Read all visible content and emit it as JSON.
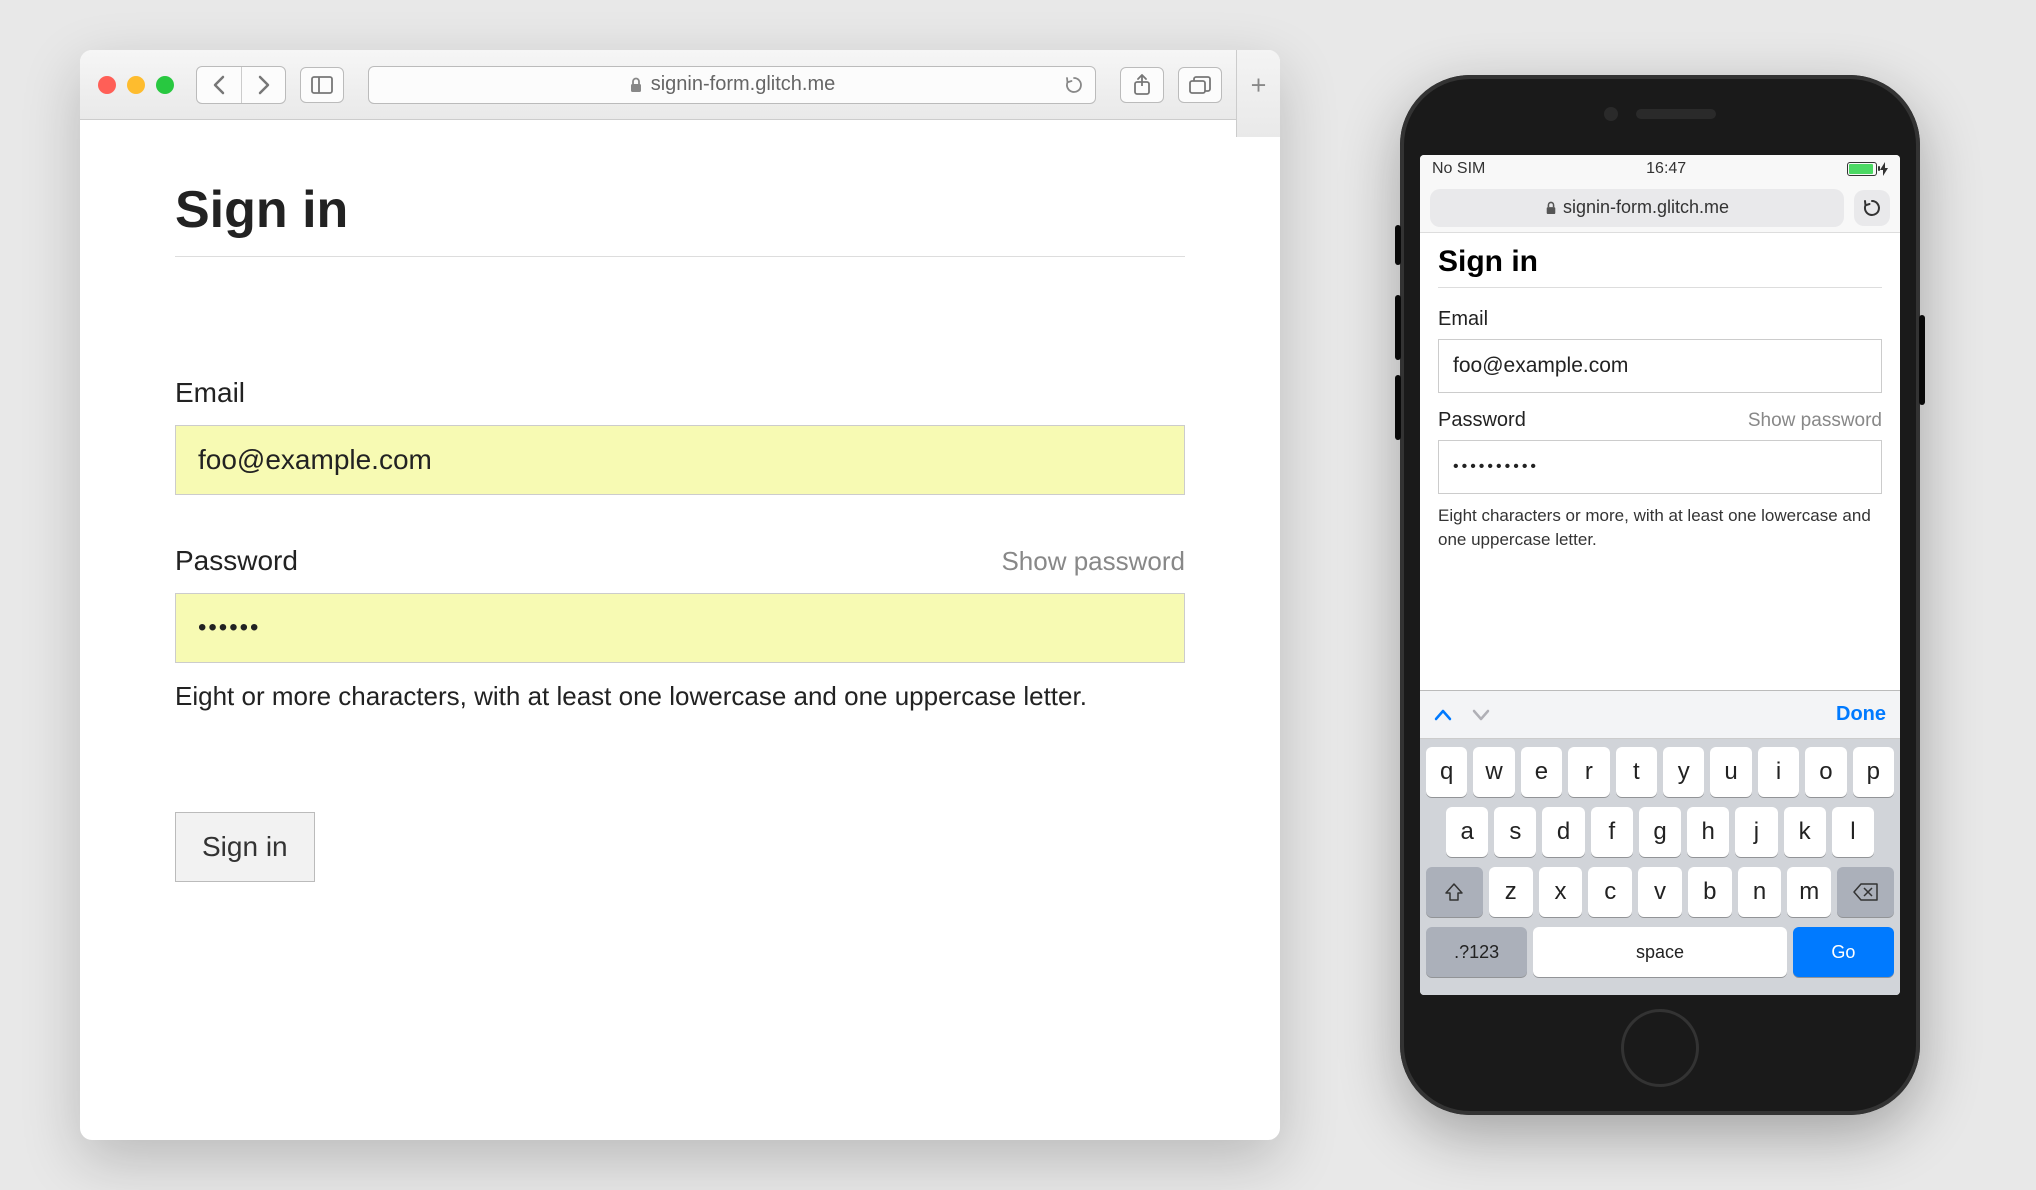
{
  "safari": {
    "url": "signin-form.glitch.me"
  },
  "page": {
    "title": "Sign in",
    "email_label": "Email",
    "email_value": "foo@example.com",
    "password_label": "Password",
    "show_password_label": "Show password",
    "password_value": "••••••",
    "password_hint": "Eight or more characters, with at least one lowercase and one uppercase letter.",
    "submit_label": "Sign in"
  },
  "iphone": {
    "status": {
      "carrier": "No SIM",
      "time": "16:47"
    },
    "url": "signin-form.glitch.me",
    "page": {
      "title": "Sign in",
      "email_label": "Email",
      "email_value": "foo@example.com",
      "password_label": "Password",
      "show_password_label": "Show password",
      "password_value": "••••••••••",
      "password_hint": "Eight characters or more, with at least one lowercase and one uppercase letter."
    },
    "keyboard": {
      "done_label": "Done",
      "rows": {
        "r1": [
          "q",
          "w",
          "e",
          "r",
          "t",
          "y",
          "u",
          "i",
          "o",
          "p"
        ],
        "r2": [
          "a",
          "s",
          "d",
          "f",
          "g",
          "h",
          "j",
          "k",
          "l"
        ],
        "r3": [
          "z",
          "x",
          "c",
          "v",
          "b",
          "n",
          "m"
        ]
      },
      "numbers_label": ".?123",
      "space_label": "space",
      "go_label": "Go"
    }
  }
}
